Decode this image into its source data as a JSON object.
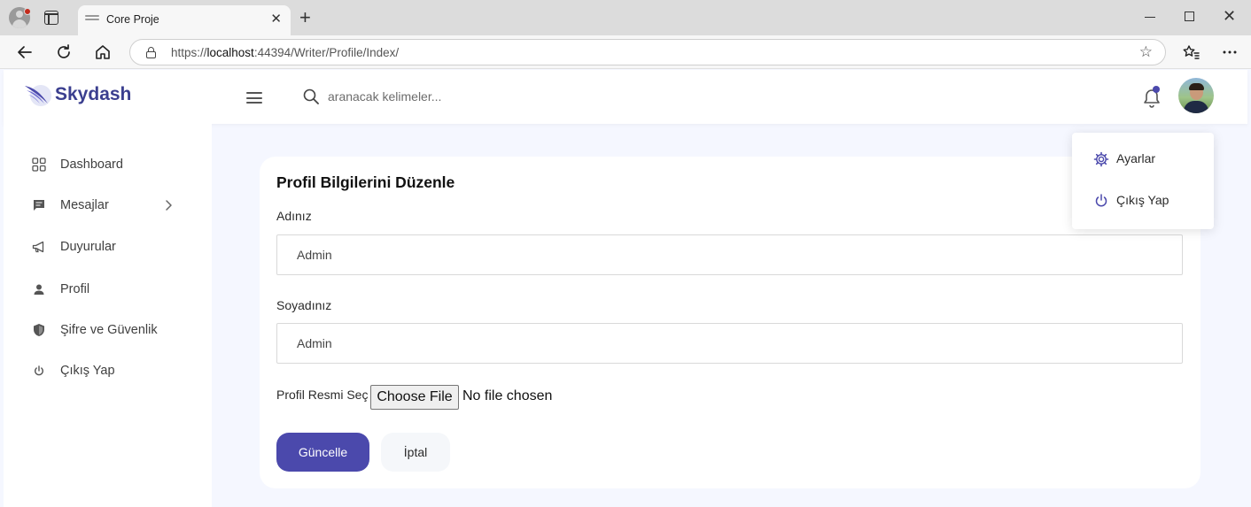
{
  "browser": {
    "tab_title": "Core Proje",
    "close_glyph": "✕",
    "newtab_glyph": "+",
    "url_prefix": "https://",
    "url_host": "localhost",
    "url_rest": ":44394/Writer/Profile/Index/"
  },
  "header": {
    "brand": "Skydash",
    "search_placeholder": "aranacak kelimeler..."
  },
  "sidebar": {
    "items": [
      {
        "label": "Dashboard",
        "icon": "grid-icon"
      },
      {
        "label": "Mesajlar",
        "icon": "message-icon"
      },
      {
        "label": "Duyurular",
        "icon": "megaphone-icon"
      },
      {
        "label": "Profil",
        "icon": "person-icon"
      },
      {
        "label": "Şifre ve Güvenlik",
        "icon": "shield-icon"
      },
      {
        "label": "Çıkış Yap",
        "icon": "power-icon"
      }
    ]
  },
  "form": {
    "title": "Profil Bilgilerini Düzenle",
    "first_name_label": "Adınız",
    "first_name_value": "Admin",
    "last_name_label": "Soyadınız",
    "last_name_value": "Admin",
    "photo_label": "Profil Resmi Seç",
    "file_button": "Choose File",
    "file_status": "No file chosen",
    "submit_label": "Güncelle",
    "cancel_label": "İptal"
  },
  "dropdown": {
    "settings_label": "Ayarlar",
    "logout_label": "Çıkış Yap"
  },
  "colors": {
    "accent": "#4b49ac",
    "page_bg": "#f5f7ff"
  }
}
